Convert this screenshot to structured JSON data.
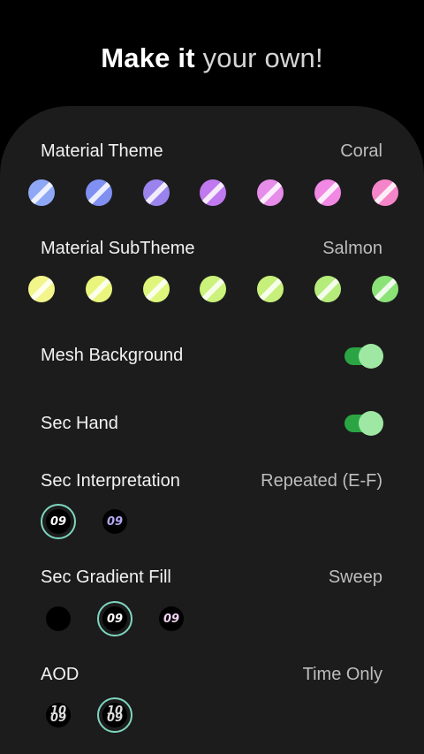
{
  "header": {
    "title_prefix": "Make it",
    "title_accent": "your own!"
  },
  "material_theme": {
    "label": "Material Theme",
    "value": "Coral",
    "swatches": [
      "#8fa8f6",
      "#7f8ff2",
      "#9b83ee",
      "#c079ee",
      "#e68ce9",
      "#f188e3",
      "#f585c9"
    ]
  },
  "material_subtheme": {
    "label": "Material SubTheme",
    "value": "Salmon",
    "swatches": [
      "#f2f58a",
      "#e9f57c",
      "#dff67c",
      "#cbf27a",
      "#c7f07a",
      "#b5ec7c",
      "#8be276"
    ]
  },
  "mesh_background": {
    "label": "Mesh Background",
    "on": true
  },
  "sec_hand": {
    "label": "Sec Hand",
    "on": true
  },
  "sec_interpretation": {
    "label": "Sec Interpretation",
    "value": "Repeated (E-F)",
    "options": [
      {
        "text": "09",
        "color": "#ffffff",
        "selected": true
      },
      {
        "text": "09",
        "color": "#b4a8f2",
        "selected": false
      }
    ]
  },
  "sec_gradient_fill": {
    "label": "Sec Gradient Fill",
    "value": "Sweep",
    "options": [
      {
        "text": "",
        "color": "#000000",
        "selected": false
      },
      {
        "text": "09",
        "color": "#ffffff",
        "selected": true
      },
      {
        "text": "09",
        "color": "#f0d4f2",
        "selected": false
      }
    ]
  },
  "aod": {
    "label": "AOD",
    "value": "Time Only",
    "options": [
      {
        "line1": "10",
        "line2": "09",
        "selected": false
      },
      {
        "line1": "10",
        "line2": "09",
        "selected": true
      }
    ]
  },
  "colors": {
    "card": "#1c1c1c",
    "toggle_track": "#2ba544",
    "toggle_knob": "#9fe8a3",
    "selection_ring": "#7fd6bf"
  }
}
